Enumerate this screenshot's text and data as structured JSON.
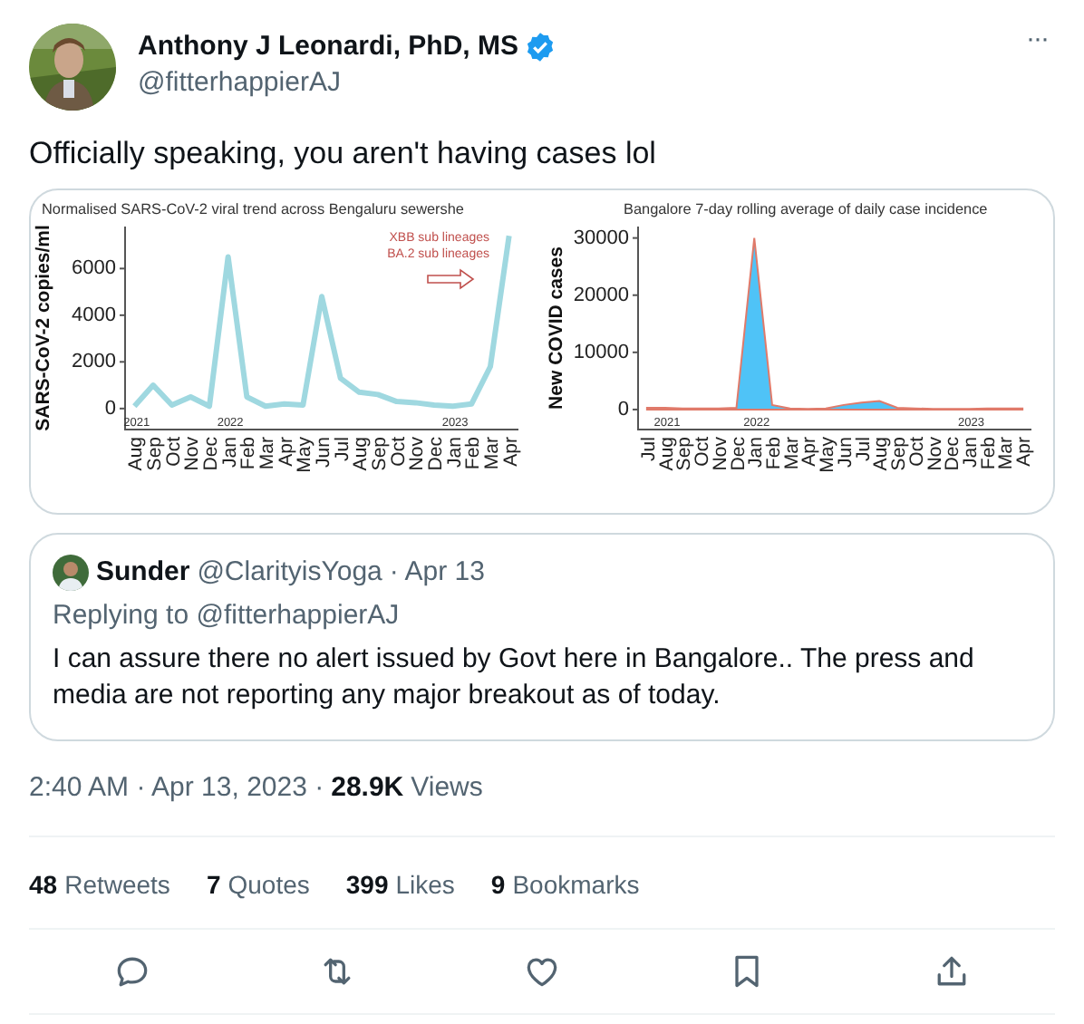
{
  "author": {
    "name": "Anthony J Leonardi, PhD, MS",
    "verified": true,
    "handle": "@fitterhappierAJ"
  },
  "more_button": "···",
  "text": "Officially speaking, you aren't having cases lol",
  "media": [
    {
      "chart_data": {
        "type": "line",
        "title": "Normalised SARS-CoV-2 viral trend across Bengaluru sewershe",
        "ylabel": "SARS-CoV-2 copies/ml",
        "categories": [
          "Aug",
          "Sep",
          "Oct",
          "Nov",
          "Dec",
          "Jan",
          "Feb",
          "Mar",
          "Apr",
          "May",
          "Jun",
          "Jul",
          "Aug",
          "Sep",
          "Oct",
          "Nov",
          "Dec",
          "Jan",
          "Feb",
          "Mar",
          "Apr"
        ],
        "series": [
          {
            "color": "#9fd8e0",
            "values": [
              100,
              1000,
              150,
              500,
              100,
              6500,
              500,
              100,
              200,
              150,
              4800,
              1300,
              700,
              600,
              300,
              250,
              150,
              100,
              200,
              1800,
              7400
            ]
          }
        ],
        "ylim": [
          -900,
          7800
        ],
        "yticks": [
          0,
          2000,
          4000,
          6000
        ],
        "annotations": [
          "2021",
          "2022",
          "2023",
          "XBB sub lineages",
          "BA.2 sub lineages"
        ]
      }
    },
    {
      "chart_data": {
        "type": "area",
        "title": "Bangalore 7-day rolling average of daily case incidence",
        "ylabel": "New COVID cases",
        "categories": [
          "Jul",
          "Aug",
          "Sep",
          "Oct",
          "Nov",
          "Dec",
          "Jan",
          "Feb",
          "Mar",
          "Apr",
          "May",
          "Jun",
          "Jul",
          "Aug",
          "Sep",
          "Oct",
          "Nov",
          "Dec",
          "Jan",
          "Feb",
          "Mar",
          "Apr"
        ],
        "series": [
          {
            "color": "#4fc3f7",
            "values": [
              300,
              300,
              200,
              200,
              200,
              300,
              30000,
              800,
              200,
              100,
              200,
              800,
              1200,
              1500,
              300,
              200,
              100,
              100,
              100,
              200,
              200,
              200
            ]
          }
        ],
        "ylim": [
          -3500,
          32000
        ],
        "yticks": [
          0,
          10000,
          20000,
          30000
        ],
        "annotations": [
          "2021",
          "2022",
          "2023"
        ]
      }
    }
  ],
  "quote": {
    "name": "Sunder",
    "handle": "@ClarityisYoga",
    "date": "· Apr 13",
    "replying_to": "Replying to @fitterhappierAJ",
    "text": "I can assure there no alert issued by Govt here in Bangalore.. The press and media are not reporting any major breakout as of today."
  },
  "meta": {
    "time": "2:40 AM · Apr 13, 2023 ·",
    "views_count": "28.9K",
    "views_label": "Views"
  },
  "stats": [
    {
      "count": "48",
      "label": "Retweets"
    },
    {
      "count": "7",
      "label": "Quotes"
    },
    {
      "count": "399",
      "label": "Likes"
    },
    {
      "count": "9",
      "label": "Bookmarks"
    }
  ],
  "actions": [
    {
      "kind": "reply"
    },
    {
      "kind": "retweet"
    },
    {
      "kind": "like"
    },
    {
      "kind": "bookmark"
    },
    {
      "kind": "share"
    }
  ]
}
